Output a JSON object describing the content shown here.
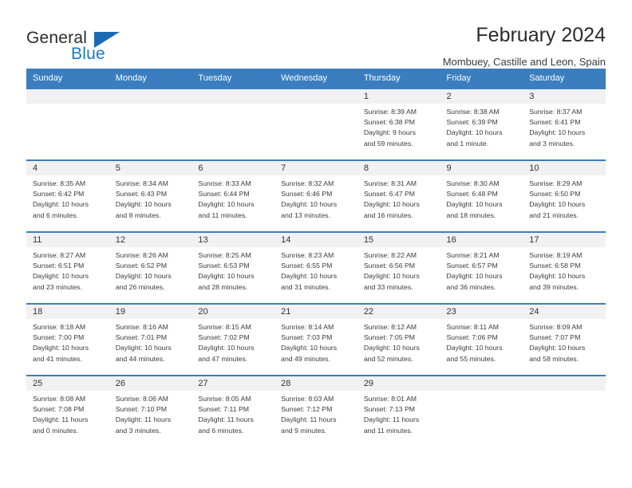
{
  "brand": {
    "name_top": "General",
    "name_bottom": "Blue",
    "accent_color": "#1878c8",
    "triangle_color": "#1a6bb5"
  },
  "header": {
    "title": "February 2024",
    "subtitle": "Mombuey, Castille and Leon, Spain"
  },
  "theme": {
    "header_bg": "#3a7ebf",
    "daynum_bg": "#f1f1f1",
    "text": "#3b3b3b"
  },
  "weekdays": [
    "Sunday",
    "Monday",
    "Tuesday",
    "Wednesday",
    "Thursday",
    "Friday",
    "Saturday"
  ],
  "weeks": [
    [
      {
        "day": "",
        "lines": []
      },
      {
        "day": "",
        "lines": []
      },
      {
        "day": "",
        "lines": []
      },
      {
        "day": "",
        "lines": []
      },
      {
        "day": "1",
        "lines": [
          "Sunrise: 8:39 AM",
          "Sunset: 6:38 PM",
          "Daylight: 9 hours",
          "and 59 minutes."
        ]
      },
      {
        "day": "2",
        "lines": [
          "Sunrise: 8:38 AM",
          "Sunset: 6:39 PM",
          "Daylight: 10 hours",
          "and 1 minute."
        ]
      },
      {
        "day": "3",
        "lines": [
          "Sunrise: 8:37 AM",
          "Sunset: 6:41 PM",
          "Daylight: 10 hours",
          "and 3 minutes."
        ]
      }
    ],
    [
      {
        "day": "4",
        "lines": [
          "Sunrise: 8:35 AM",
          "Sunset: 6:42 PM",
          "Daylight: 10 hours",
          "and 6 minutes."
        ]
      },
      {
        "day": "5",
        "lines": [
          "Sunrise: 8:34 AM",
          "Sunset: 6:43 PM",
          "Daylight: 10 hours",
          "and 8 minutes."
        ]
      },
      {
        "day": "6",
        "lines": [
          "Sunrise: 8:33 AM",
          "Sunset: 6:44 PM",
          "Daylight: 10 hours",
          "and 11 minutes."
        ]
      },
      {
        "day": "7",
        "lines": [
          "Sunrise: 8:32 AM",
          "Sunset: 6:46 PM",
          "Daylight: 10 hours",
          "and 13 minutes."
        ]
      },
      {
        "day": "8",
        "lines": [
          "Sunrise: 8:31 AM",
          "Sunset: 6:47 PM",
          "Daylight: 10 hours",
          "and 16 minutes."
        ]
      },
      {
        "day": "9",
        "lines": [
          "Sunrise: 8:30 AM",
          "Sunset: 6:48 PM",
          "Daylight: 10 hours",
          "and 18 minutes."
        ]
      },
      {
        "day": "10",
        "lines": [
          "Sunrise: 8:29 AM",
          "Sunset: 6:50 PM",
          "Daylight: 10 hours",
          "and 21 minutes."
        ]
      }
    ],
    [
      {
        "day": "11",
        "lines": [
          "Sunrise: 8:27 AM",
          "Sunset: 6:51 PM",
          "Daylight: 10 hours",
          "and 23 minutes."
        ]
      },
      {
        "day": "12",
        "lines": [
          "Sunrise: 8:26 AM",
          "Sunset: 6:52 PM",
          "Daylight: 10 hours",
          "and 26 minutes."
        ]
      },
      {
        "day": "13",
        "lines": [
          "Sunrise: 8:25 AM",
          "Sunset: 6:53 PM",
          "Daylight: 10 hours",
          "and 28 minutes."
        ]
      },
      {
        "day": "14",
        "lines": [
          "Sunrise: 8:23 AM",
          "Sunset: 6:55 PM",
          "Daylight: 10 hours",
          "and 31 minutes."
        ]
      },
      {
        "day": "15",
        "lines": [
          "Sunrise: 8:22 AM",
          "Sunset: 6:56 PM",
          "Daylight: 10 hours",
          "and 33 minutes."
        ]
      },
      {
        "day": "16",
        "lines": [
          "Sunrise: 8:21 AM",
          "Sunset: 6:57 PM",
          "Daylight: 10 hours",
          "and 36 minutes."
        ]
      },
      {
        "day": "17",
        "lines": [
          "Sunrise: 8:19 AM",
          "Sunset: 6:58 PM",
          "Daylight: 10 hours",
          "and 39 minutes."
        ]
      }
    ],
    [
      {
        "day": "18",
        "lines": [
          "Sunrise: 8:18 AM",
          "Sunset: 7:00 PM",
          "Daylight: 10 hours",
          "and 41 minutes."
        ]
      },
      {
        "day": "19",
        "lines": [
          "Sunrise: 8:16 AM",
          "Sunset: 7:01 PM",
          "Daylight: 10 hours",
          "and 44 minutes."
        ]
      },
      {
        "day": "20",
        "lines": [
          "Sunrise: 8:15 AM",
          "Sunset: 7:02 PM",
          "Daylight: 10 hours",
          "and 47 minutes."
        ]
      },
      {
        "day": "21",
        "lines": [
          "Sunrise: 8:14 AM",
          "Sunset: 7:03 PM",
          "Daylight: 10 hours",
          "and 49 minutes."
        ]
      },
      {
        "day": "22",
        "lines": [
          "Sunrise: 8:12 AM",
          "Sunset: 7:05 PM",
          "Daylight: 10 hours",
          "and 52 minutes."
        ]
      },
      {
        "day": "23",
        "lines": [
          "Sunrise: 8:11 AM",
          "Sunset: 7:06 PM",
          "Daylight: 10 hours",
          "and 55 minutes."
        ]
      },
      {
        "day": "24",
        "lines": [
          "Sunrise: 8:09 AM",
          "Sunset: 7:07 PM",
          "Daylight: 10 hours",
          "and 58 minutes."
        ]
      }
    ],
    [
      {
        "day": "25",
        "lines": [
          "Sunrise: 8:08 AM",
          "Sunset: 7:08 PM",
          "Daylight: 11 hours",
          "and 0 minutes."
        ]
      },
      {
        "day": "26",
        "lines": [
          "Sunrise: 8:06 AM",
          "Sunset: 7:10 PM",
          "Daylight: 11 hours",
          "and 3 minutes."
        ]
      },
      {
        "day": "27",
        "lines": [
          "Sunrise: 8:05 AM",
          "Sunset: 7:11 PM",
          "Daylight: 11 hours",
          "and 6 minutes."
        ]
      },
      {
        "day": "28",
        "lines": [
          "Sunrise: 8:03 AM",
          "Sunset: 7:12 PM",
          "Daylight: 11 hours",
          "and 9 minutes."
        ]
      },
      {
        "day": "29",
        "lines": [
          "Sunrise: 8:01 AM",
          "Sunset: 7:13 PM",
          "Daylight: 11 hours",
          "and 11 minutes."
        ]
      },
      {
        "day": "",
        "lines": []
      },
      {
        "day": "",
        "lines": []
      }
    ]
  ]
}
